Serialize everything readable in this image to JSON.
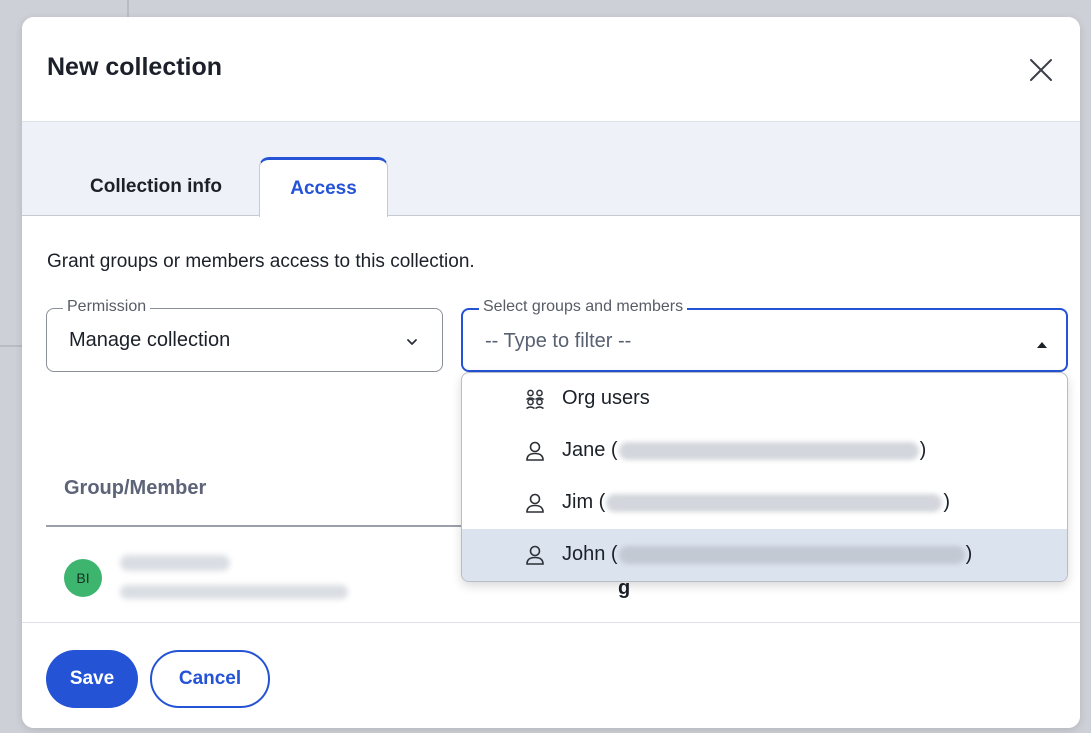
{
  "dialog": {
    "title": "New collection",
    "close_icon": "close-icon"
  },
  "tabs": [
    {
      "label": "Collection info",
      "active": false
    },
    {
      "label": "Access",
      "active": true
    }
  ],
  "access": {
    "description": "Grant groups or members access to this collection.",
    "permission": {
      "legend": "Permission",
      "value": "Manage collection",
      "icon": "chevron-down-icon"
    },
    "select": {
      "legend": "Select groups and members",
      "placeholder": "-- Type to filter --",
      "icon": "caret-up-icon"
    },
    "dropdown_options": [
      {
        "prefix": "Org users",
        "suffix": "",
        "icon": "group-icon",
        "highlighted": false
      },
      {
        "prefix": "Jane (",
        "suffix": ")",
        "icon": "user-icon",
        "highlighted": false
      },
      {
        "prefix": "Jim (",
        "suffix": ")",
        "icon": "user-icon",
        "highlighted": false
      },
      {
        "prefix": "John (",
        "suffix": ")",
        "icon": "user-icon",
        "highlighted": true
      }
    ],
    "table": {
      "column_header": "Group/Member",
      "rows": [
        {
          "avatar_initials": "BI"
        }
      ]
    }
  },
  "footer": {
    "save_label": "Save",
    "cancel_label": "Cancel"
  },
  "colors": {
    "accent": "#2453d5",
    "avatar": "#3db56f",
    "highlight": "#dbe3ef"
  }
}
